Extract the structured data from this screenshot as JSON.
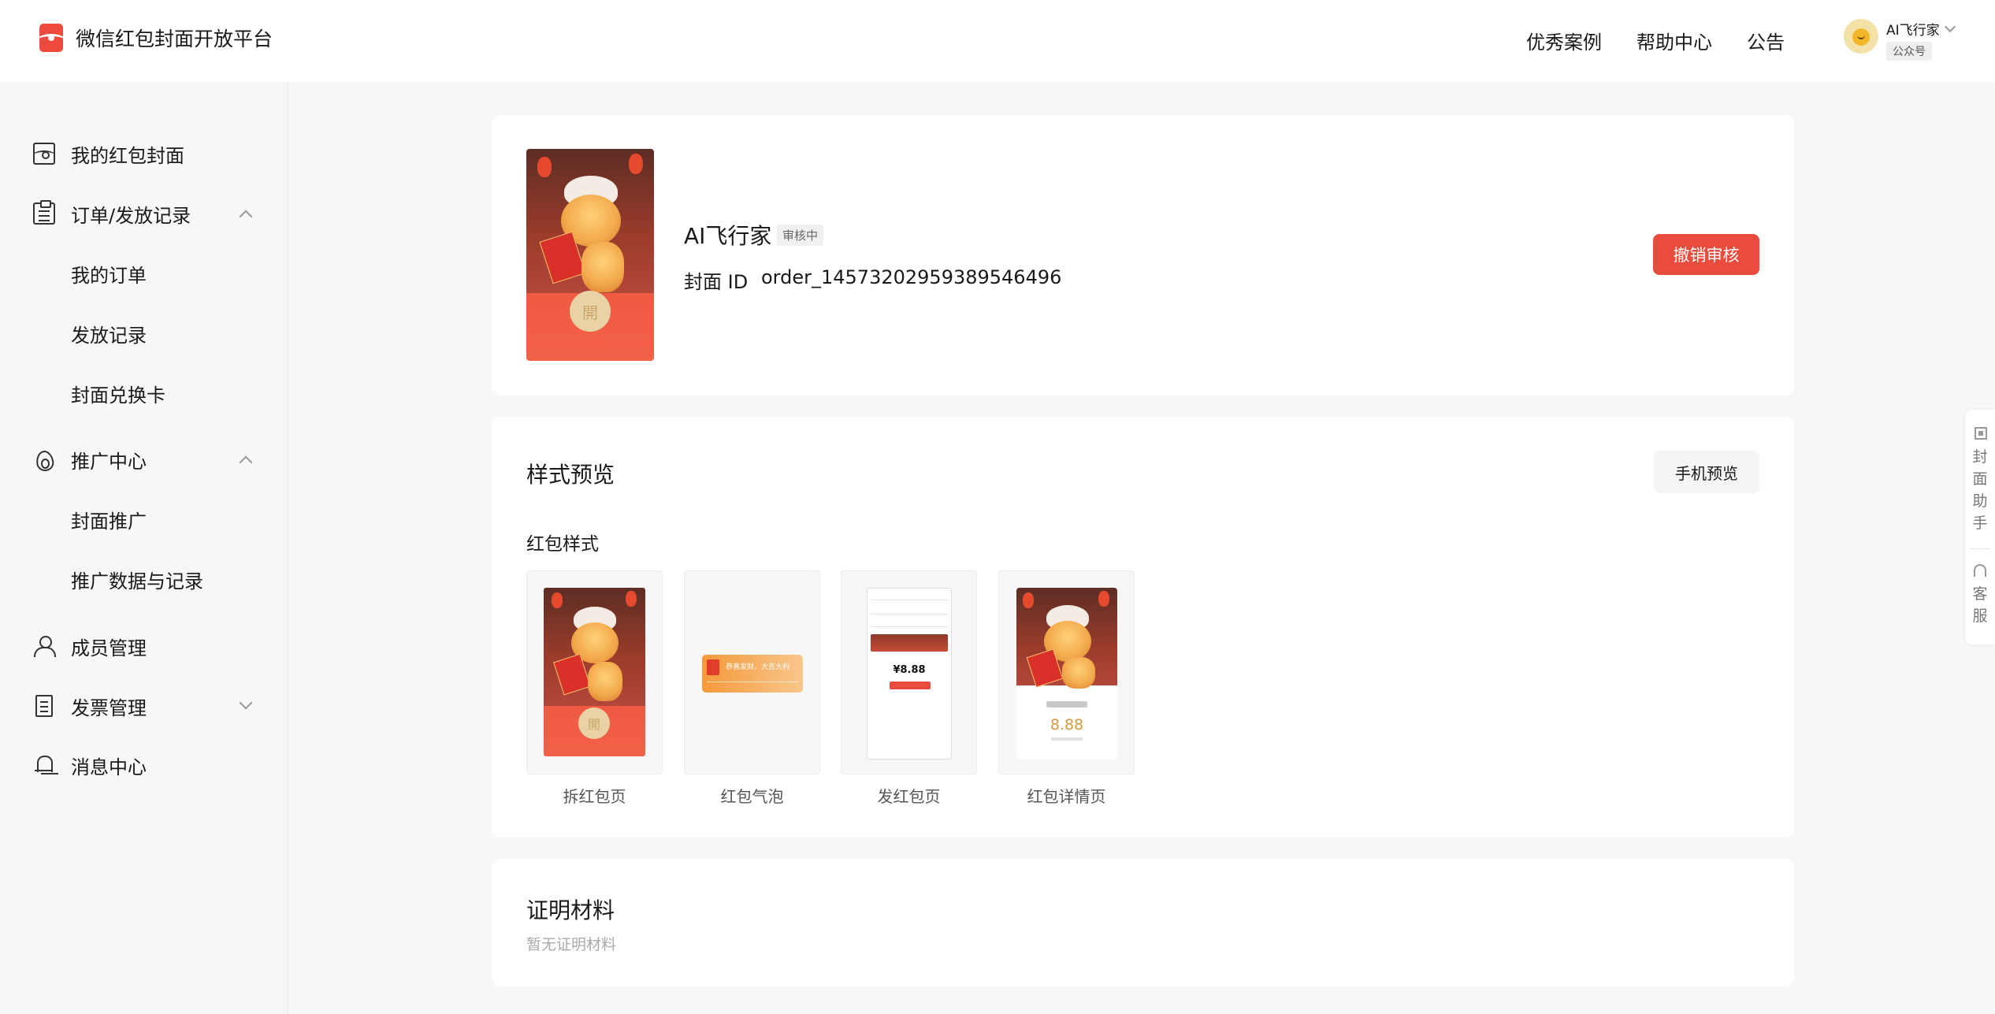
{
  "header": {
    "title": "微信红包封面开放平台",
    "nav": [
      "优秀案例",
      "帮助中心",
      "公告"
    ],
    "user": {
      "name": "AI飞行家",
      "tag": "公众号"
    }
  },
  "sidebar": {
    "items": [
      {
        "label": "我的红包封面",
        "icon": "red-packet-icon"
      },
      {
        "label": "订单/发放记录",
        "icon": "clipboard-icon",
        "expanded": true,
        "children": [
          "我的订单",
          "发放记录",
          "封面兑换卡"
        ]
      },
      {
        "label": "推广中心",
        "icon": "fire-icon",
        "expanded": true,
        "children": [
          "封面推广",
          "推广数据与记录"
        ]
      },
      {
        "label": "成员管理",
        "icon": "user-icon"
      },
      {
        "label": "发票管理",
        "icon": "invoice-icon",
        "expanded": false
      },
      {
        "label": "消息中心",
        "icon": "bell-icon"
      }
    ]
  },
  "cover": {
    "name": "AI飞行家",
    "status": "审核中",
    "id_label": "封面 ID",
    "id_value": "order_1457320295938954649​6",
    "revoke_label": "撤销审核",
    "open_glyph": "開"
  },
  "preview": {
    "title": "样式预览",
    "phone_preview_label": "手机预览",
    "subtitle": "红包样式",
    "styles": [
      "拆红包页",
      "红包气泡",
      "发红包页",
      "红包详情页"
    ],
    "send_amount": "¥8.88",
    "detail_amount": "8.88",
    "bubble_text": "恭喜发财，大吉大利"
  },
  "materials": {
    "title": "证明材料",
    "empty": "暂无证明材料"
  },
  "float_panel": {
    "assistant": "封面助手",
    "service": "客服"
  },
  "colors": {
    "accent": "#e94b3c",
    "background": "#f6f7f8",
    "card": "#ffffff"
  }
}
